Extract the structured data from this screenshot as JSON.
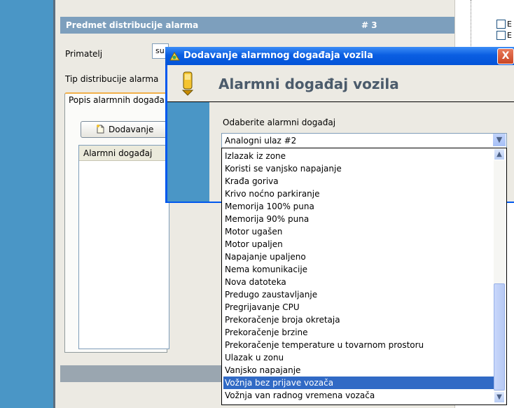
{
  "panel": {
    "title": "Predmet distribucije alarma",
    "number": "# 3",
    "primatelj_label": "Primatelj",
    "primatelj_value": "su",
    "tip_label": "Tip distribucije alarma",
    "tab_label": "Popis alarmnih događa",
    "add_button": "Dodavanje",
    "list_header": "Alarmni događaj"
  },
  "dialog": {
    "title": "Dodavanje alarmnog događaja vozila",
    "close": "X",
    "heading": "Alarmni događaj vozila",
    "select_label": "Odaberite alarmni događaj",
    "selected_value": "Analogni ulaz #2",
    "options": [
      "Izlazak iz zone",
      "Koristi se vanjsko napajanje",
      "Krađa goriva",
      "Krivo noćno parkiranje",
      "Memorija 100% puna",
      "Memorija 90% puna",
      "Motor ugašen",
      "Motor upaljen",
      "Napajanje upaljeno",
      "Nema komunikacije",
      "Nova datoteka",
      "Predugo zaustavljanje",
      "Pregrijavanje CPU",
      "Prekoračenje broja okretaja",
      "Prekoračenje brzine",
      "Prekoračenje temperature u tovarnom prostoru",
      "Ulazak u zonu",
      "Vanjsko napajanje",
      "Vožnja bez prijave vozača",
      "Vožnja van radnog vremena vozača"
    ],
    "highlighted_option": "Vožnja bez prijave vozača"
  },
  "right_tree": {
    "items": [
      "E",
      "E"
    ]
  },
  "colors": {
    "accent": "#0058ee",
    "sidebar": "#4a96c6",
    "selection": "#316ac5"
  },
  "icons": [
    "file-add-icon",
    "dialog-app-icon",
    "battery-icon",
    "dropdown-arrow-icon",
    "scroll-up-icon",
    "scroll-down-icon"
  ]
}
